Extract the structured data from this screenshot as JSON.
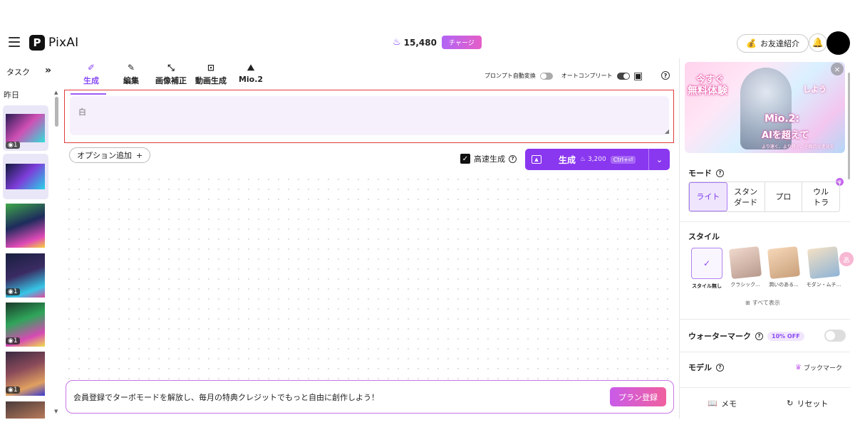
{
  "header": {
    "logo_mark": "P",
    "logo_text": "PixAI",
    "credits": "15,480",
    "credit_icon": "♨",
    "charge_label": "チャージ",
    "invite_label": "お友達紹介",
    "invite_icon": "💰",
    "bell_icon": "🔔"
  },
  "tasks": {
    "title": "タスク",
    "collapse_icon": "»",
    "date_label": "昨日",
    "items": [
      {
        "badge": "◉1"
      },
      {
        "badge": ""
      },
      {
        "badge": ""
      },
      {
        "badge": "◉1"
      },
      {
        "badge": "◉1"
      },
      {
        "badge": "◉1"
      },
      {
        "badge": ""
      }
    ]
  },
  "tools": {
    "tabs": [
      {
        "label": "生成",
        "icon": "✐"
      },
      {
        "label": "編集",
        "icon": "✎"
      },
      {
        "label": "画像補正",
        "icon": "⤡"
      },
      {
        "label": "動画生成",
        "icon": "⊡"
      },
      {
        "label": "Mio.2",
        "icon": "⛰"
      }
    ],
    "prompt_convert_label": "プロンプト自動変換",
    "autocomplete_label": "オートコンプリート",
    "layout_icon": "▣",
    "help_icon": "?"
  },
  "prompt": {
    "placeholder": "白"
  },
  "options": {
    "add_label": "オプション追加",
    "add_icon": "+",
    "fast_gen_label": "高速生成",
    "fast_gen_check": "✓",
    "help_icon": "?"
  },
  "generate": {
    "img_icon": "▲",
    "label": "生成",
    "cost": "♨ 3,200",
    "shortcut": "Ctrl+⏎",
    "dropdown_icon": "⌄"
  },
  "promo": {
    "text": "会員登録でターボモードを解放し、毎月の特典クレジットでもっと自由に創作しよう！",
    "button": "プラン登録"
  },
  "banner": {
    "line1": "今すぐ",
    "line2": "無料体験",
    "line3": "しよう",
    "line4": "Mio.2:",
    "line5": "AIを超えて",
    "line6": "より速く、より賢く。全面的な進化を",
    "close_icon": "×"
  },
  "mode": {
    "label": "モード",
    "help_icon": "?",
    "crown_icon": "♛",
    "options": [
      "ライト",
      "スタン\nダード",
      "プロ",
      "ウル\nトラ"
    ]
  },
  "style": {
    "label": "スタイル",
    "check_icon": "✓",
    "items": [
      {
        "name": "スタイル無し"
      },
      {
        "name": "クラシック..."
      },
      {
        "name": "潤いのある..."
      },
      {
        "name": "モダン・ムチ..."
      }
    ],
    "show_all_icon": "⊞",
    "show_all": "すべて表示"
  },
  "watermark": {
    "label": "ウォーターマーク",
    "help_icon": "?",
    "discount": "10% OFF"
  },
  "model": {
    "label": "モデル",
    "help_icon": "?",
    "bookmark_icon": "♛",
    "bookmark": "ブックマーク"
  },
  "footer": {
    "memo_icon": "📖",
    "memo": "メモ",
    "reset_icon": "↻",
    "reset": "リセット"
  },
  "float_icon": "あ"
}
